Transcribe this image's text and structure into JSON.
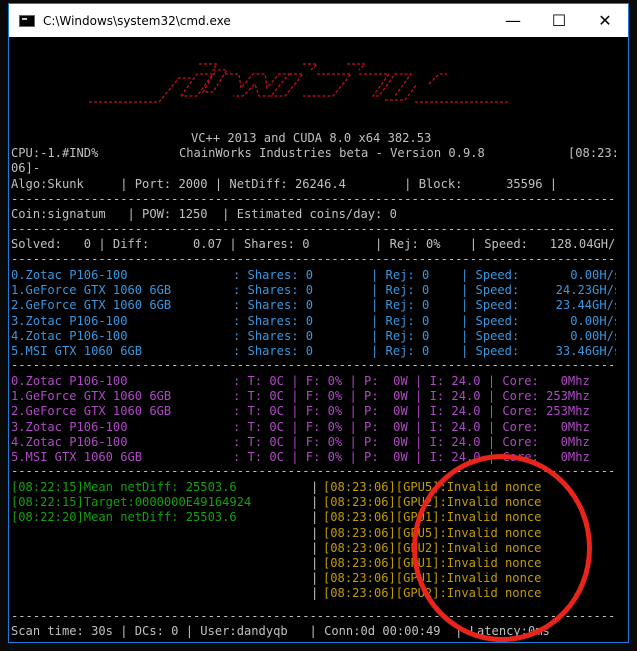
{
  "window": {
    "title": "C:\\Windows\\system32\\cmd.exe",
    "minimize": "—",
    "maximize": "☐",
    "close": "✕"
  },
  "header": {
    "build": "VC++ 2013 and CUDA 8.0 x64 382.53",
    "cpu": "CPU:-1.#IND%",
    "company": "ChainWorks Industries beta - Version 0.9.8",
    "time_part1": "[08:23:",
    "time_part2": "06]-"
  },
  "stats": {
    "algo_row": "Algo:Skunk     | Port: 2000 | NetDiff: 26246.4        | Block:      35596 |",
    "coin_row": "Coin:signatum   | POW: 1250  | Estimated coins/day: 0",
    "solved_row": "Solved:   0 | Diff:      0.07 | Shares: 0         | Rej: 0%    | Speed:   128.04GH/s",
    "dash": "--------------------------------------------------------------------------------------------------------"
  },
  "gpus": [
    {
      "name": "0.Zotac P106-100",
      "shares": ": Shares: 0",
      "rej": "| Rej: 0",
      "speed": "| Speed:       0.00H/s",
      "temp": ": T: 0C | F: 0% | P:  0W | I: 24.0 | Core:   0Mhz"
    },
    {
      "name": "1.GeForce GTX 1060 6GB",
      "shares": ": Shares: 0",
      "rej": "| Rej: 0",
      "speed": "| Speed:     24.23GH/s",
      "temp": ": T: 0C | F: 0% | P:  0W | I: 24.0 | Core: 253Mhz"
    },
    {
      "name": "2.GeForce GTX 1060 6GB",
      "shares": ": Shares: 0",
      "rej": "| Rej: 0",
      "speed": "| Speed:     23.44GH/s",
      "temp": ": T: 0C | F: 0% | P:  0W | I: 24.0 | Core: 253Mhz"
    },
    {
      "name": "3.Zotac P106-100",
      "shares": ": Shares: 0",
      "rej": "| Rej: 0",
      "speed": "| Speed:       0.00H/s",
      "temp": ": T: 0C | F: 0% | P:  0W | I: 24.0 | Core:   0Mhz"
    },
    {
      "name": "4.Zotac P106-100",
      "shares": ": Shares: 0",
      "rej": "| Rej: 0",
      "speed": "| Speed:       0.00H/s",
      "temp": ": T: 0C | F: 0% | P:  0W | I: 24.0 | Core:   0Mhz"
    },
    {
      "name": "5.MSI GTX 1060 6GB",
      "shares": ": Shares: 0",
      "rej": "| Rej: 0",
      "speed": "| Speed:     33.46GH/s",
      "temp": ": T: 0C | F: 0% | P:  0W | I: 24.0 | Core:   0Mhz"
    }
  ],
  "log_left": [
    "[08:22:15]Mean netDiff: 25503.6",
    "[08:22:15]Target:0000000E49164924",
    "[08:22:20]Mean netDiff: 25503.6"
  ],
  "log_right": [
    "[08:23:06][GPU5]:Invalid nonce",
    "[08:23:06][GPU2]:Invalid nonce",
    "[08:23:06][GPU1]:Invalid nonce",
    "[08:23:06][GPU5]:Invalid nonce",
    "[08:23:06][GPU2]:Invalid nonce",
    "[08:23:06][GPU1]:Invalid nonce",
    "[08:23:06][GPU1]:Invalid nonce",
    "[08:23:06][GPU2]:Invalid nonce"
  ],
  "footer": "Scan time: 30s | DCs: 0 | User:dandyqb   | Conn:0d 00:00:49  | Latency:0ms",
  "colors": {
    "cyan": "#3a96dd",
    "magenta": "#b148c6",
    "green": "#13a10e",
    "yellow": "#c19c00",
    "red": "#c50f1f",
    "annotation": "#e8241b"
  }
}
